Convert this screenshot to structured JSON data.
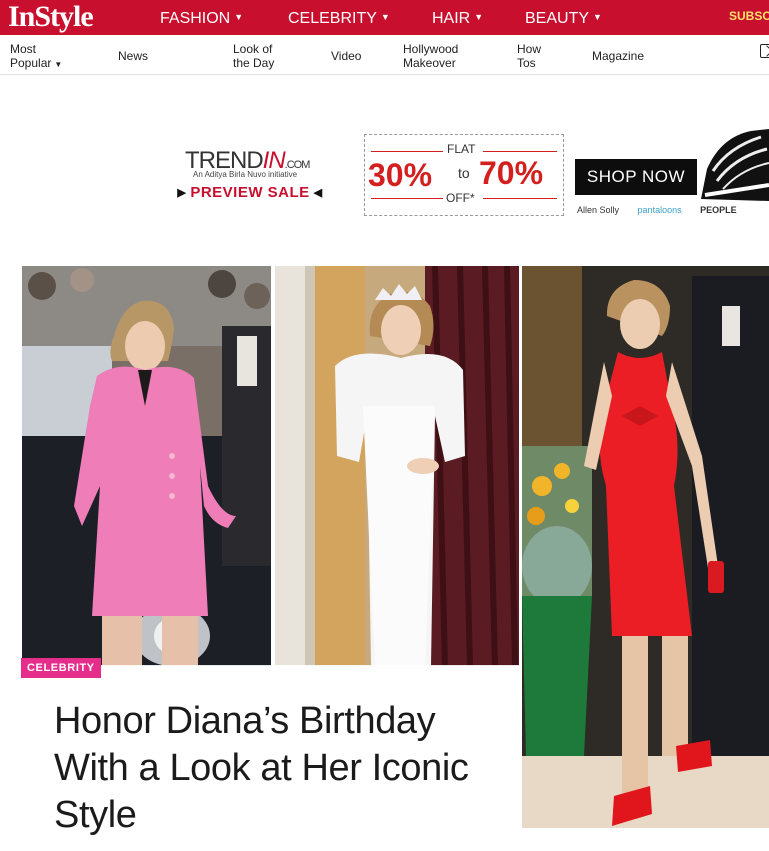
{
  "brand": {
    "logo_text": "InStyle"
  },
  "top_nav": {
    "items": [
      {
        "label": "FASHION"
      },
      {
        "label": "CELEBRITY"
      },
      {
        "label": "HAIR"
      },
      {
        "label": "BEAUTY"
      }
    ],
    "subscribe_label": "SUBSC"
  },
  "sub_nav": {
    "items": [
      {
        "label": "Most\nPopular",
        "has_dropdown": true
      },
      {
        "label": "News"
      },
      {
        "label": "Look of\nthe Day"
      },
      {
        "label": "Video"
      },
      {
        "label": "Hollywood\nMakeover"
      },
      {
        "label": "How\nTos"
      },
      {
        "label": "Magazine"
      }
    ]
  },
  "ad": {
    "logo_trend": "TREND",
    "logo_in": "IN",
    "logo_com": ".COM",
    "tagline": "An Aditya Birla Nuvo initiative",
    "preview_sale": "PREVIEW SALE",
    "flat": "FLAT",
    "pct_low": "30%",
    "to": "to",
    "pct_high": "70%",
    "off": "OFF*",
    "shop_now": "SHOP NOW",
    "brands": [
      "Allen Solly",
      "pantaloons",
      "PEOPLE"
    ],
    "colors": {
      "accent": "#d41f1f",
      "shop_bg": "#0d0d0d"
    }
  },
  "article": {
    "category": "CELEBRITY",
    "headline": "Honor Diana’s Birthday With a Look at Her Iconic Style",
    "colors": {
      "tag_bg": "#e52d8c",
      "nav_red": "#c8102e"
    }
  }
}
